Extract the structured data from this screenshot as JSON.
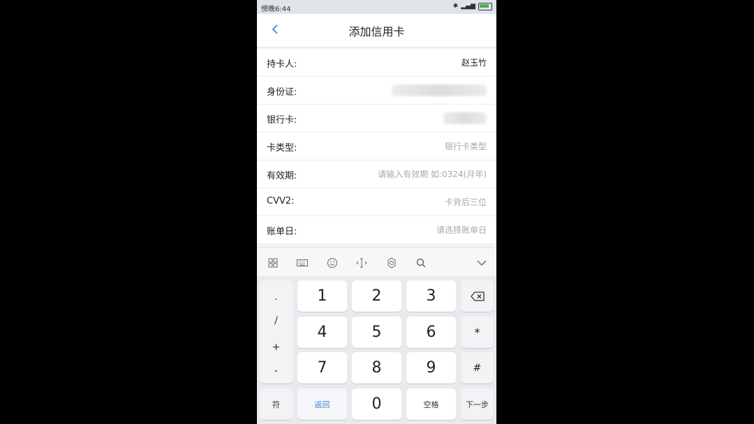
{
  "status": {
    "time": "傍晚6:44"
  },
  "nav": {
    "title": "添加信用卡"
  },
  "form": {
    "holder_label": "持卡人:",
    "holder_value": "赵玉竹",
    "id_label": "身份证:",
    "card_label": "银行卡:",
    "card_type_label": "卡类型:",
    "card_type_placeholder": "银行卡类型",
    "expiry_label": "有效期:",
    "expiry_placeholder": "请输入有效期 如:0324(月年)",
    "cvv_label": "CVV2:",
    "cvv_placeholder": "卡背后三位",
    "bill_day_label": "账单日:",
    "bill_day_placeholder": "请选择账单日"
  },
  "keyboard": {
    "symbols": [
      ".",
      "/",
      "+",
      "-"
    ],
    "digits": [
      "1",
      "2",
      "3",
      "4",
      "5",
      "6",
      "7",
      "8",
      "9",
      "0"
    ],
    "star": "*",
    "hash": "#",
    "fu": "符",
    "back_label": "返回",
    "space_label": "空格",
    "next_label": "下一步"
  },
  "colors": {
    "accent": "#3a86d9",
    "background": "#f2f2f4",
    "keyboard": "#e9eaee"
  }
}
